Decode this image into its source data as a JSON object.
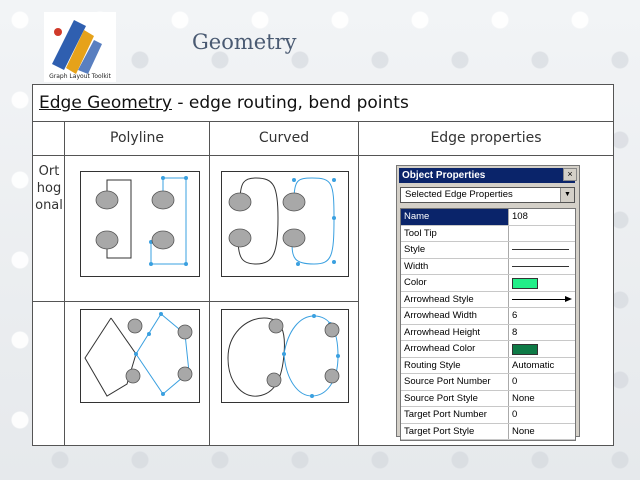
{
  "header": {
    "logo_text": "Graph Layout Toolkit",
    "title": "Geometry"
  },
  "table": {
    "heading_main": "Edge Geometry",
    "heading_rest": " - edge routing, bend points",
    "columns": [
      "Polyline",
      "Curved",
      "Edge properties"
    ],
    "row_label": "Orthogonal"
  },
  "properties_panel": {
    "title": "Object Properties",
    "close_glyph": "×",
    "selector_value": "Selected Edge Properties",
    "rows": [
      {
        "name": "Name",
        "value": "108",
        "kind": "text",
        "selected": true
      },
      {
        "name": "Tool Tip",
        "value": "",
        "kind": "text"
      },
      {
        "name": "Style",
        "value": "",
        "kind": "line"
      },
      {
        "name": "Width",
        "value": "",
        "kind": "line"
      },
      {
        "name": "Color",
        "value": "",
        "kind": "swatch",
        "color": "#22ee88"
      },
      {
        "name": "Arrowhead Style",
        "value": "",
        "kind": "arrow"
      },
      {
        "name": "Arrowhead Width",
        "value": "6",
        "kind": "text"
      },
      {
        "name": "Arrowhead Height",
        "value": "8",
        "kind": "text"
      },
      {
        "name": "Arrowhead Color",
        "value": "",
        "kind": "swatch",
        "color": "#0e7a46"
      },
      {
        "name": "Routing Style",
        "value": "Automatic",
        "kind": "text"
      },
      {
        "name": "Source Port Number",
        "value": "0",
        "kind": "text"
      },
      {
        "name": "Source Port Style",
        "value": "None",
        "kind": "text"
      },
      {
        "name": "Target Port Number",
        "value": "0",
        "kind": "text"
      },
      {
        "name": "Target Port Style",
        "value": "None",
        "kind": "text"
      }
    ]
  },
  "colors": {
    "title": "#4a5a72",
    "edge_highlight": "#3aa0e0",
    "node_fill": "#a8a8a8",
    "selection": "#0a246a"
  }
}
